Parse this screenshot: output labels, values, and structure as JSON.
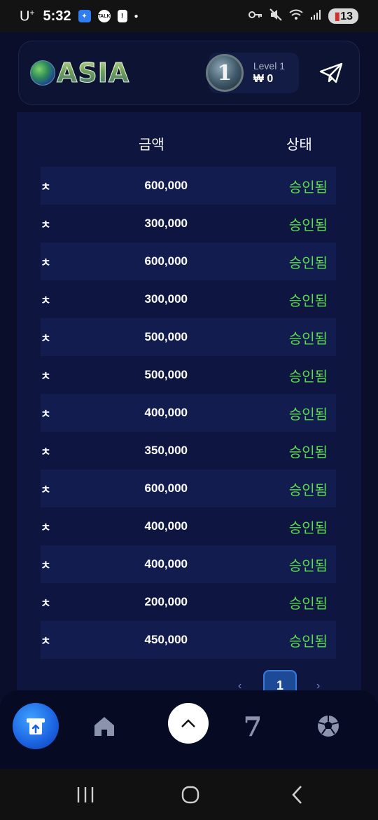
{
  "status_bar": {
    "carrier": "U",
    "carrier_sup": "+",
    "time": "5:32",
    "talk_label": "TALK",
    "battery": "13"
  },
  "header": {
    "logo_text": "ASIA",
    "level_badge": "1",
    "level_label": "Level 1",
    "balance": "₩ 0"
  },
  "table": {
    "columns": [
      "금액",
      "상태"
    ],
    "rows": [
      {
        "a": "ㅊ",
        "amount": "600,000",
        "status": "승인됨"
      },
      {
        "a": "ㅊ",
        "amount": "300,000",
        "status": "승인됨"
      },
      {
        "a": "ㅊ",
        "amount": "600,000",
        "status": "승인됨"
      },
      {
        "a": "ㅊ",
        "amount": "300,000",
        "status": "승인됨"
      },
      {
        "a": "ㅊ",
        "amount": "500,000",
        "status": "승인됨"
      },
      {
        "a": "ㅊ",
        "amount": "500,000",
        "status": "승인됨"
      },
      {
        "a": "ㅊ",
        "amount": "400,000",
        "status": "승인됨"
      },
      {
        "a": "ㅊ",
        "amount": "350,000",
        "status": "승인됨"
      },
      {
        "a": "ㅊ",
        "amount": "600,000",
        "status": "승인됨"
      },
      {
        "a": "ㅊ",
        "amount": "400,000",
        "status": "승인됨"
      },
      {
        "a": "ㅊ",
        "amount": "400,000",
        "status": "승인됨"
      },
      {
        "a": "ㅊ",
        "amount": "200,000",
        "status": "승인됨"
      },
      {
        "a": "ㅊ",
        "amount": "450,000",
        "status": "승인됨"
      }
    ]
  },
  "pagination": {
    "prev": "‹",
    "current": "1",
    "next": "›"
  },
  "bottom_nav": {
    "slot_label": "7"
  },
  "colors": {
    "background": "#0a0e2a",
    "panel": "#0e1640",
    "status_approved": "#5bdc4a",
    "accent": "#1b62e0"
  }
}
